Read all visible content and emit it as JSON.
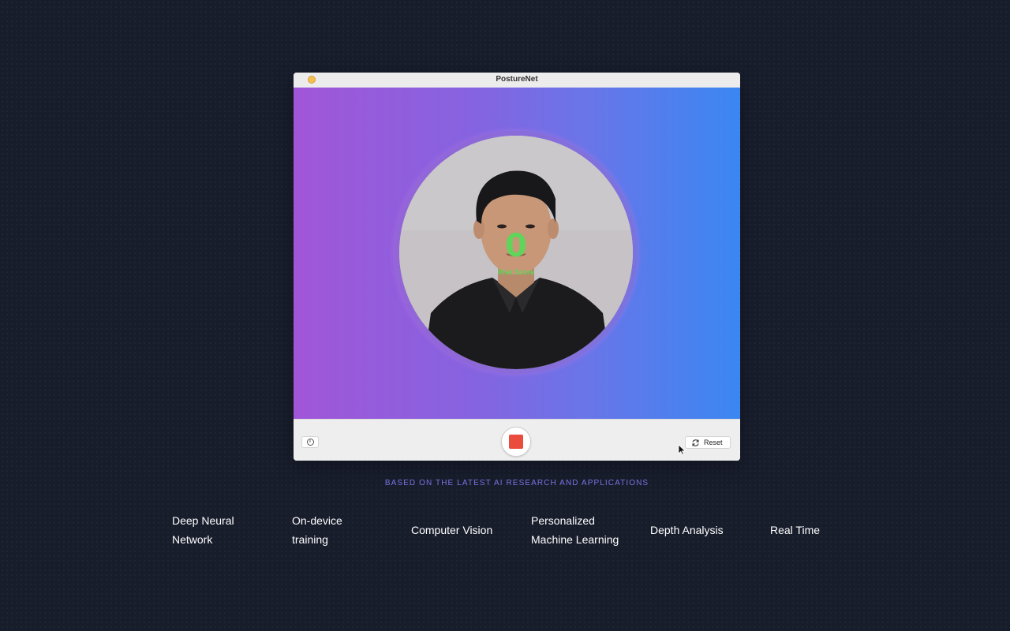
{
  "window": {
    "title": "PostureNet"
  },
  "score": {
    "value": "0",
    "label": "Risk Score",
    "color": "#5fd65a"
  },
  "toolbar": {
    "info_icon": "info-icon",
    "info_glyph": "i",
    "record_icon": "stop-icon",
    "reset_label": "Reset",
    "reset_icon": "refresh-icon"
  },
  "tagline": "BASED ON THE LATEST AI RESEARCH AND APPLICATIONS",
  "features": [
    {
      "lines": [
        "Deep Neural",
        "Network"
      ]
    },
    {
      "lines": [
        "On-device",
        "training"
      ]
    },
    {
      "lines": [
        "Computer Vision"
      ]
    },
    {
      "lines": [
        "Personalized",
        "Machine Learning"
      ]
    },
    {
      "lines": [
        "Depth Analysis"
      ]
    },
    {
      "lines": [
        "Real Time"
      ]
    }
  ],
  "colors": {
    "background": "#181d2c",
    "gradient_start": "#a156d8",
    "gradient_end": "#3a87f2",
    "tagline": "#7a73e3",
    "stop": "#e94b3c"
  }
}
